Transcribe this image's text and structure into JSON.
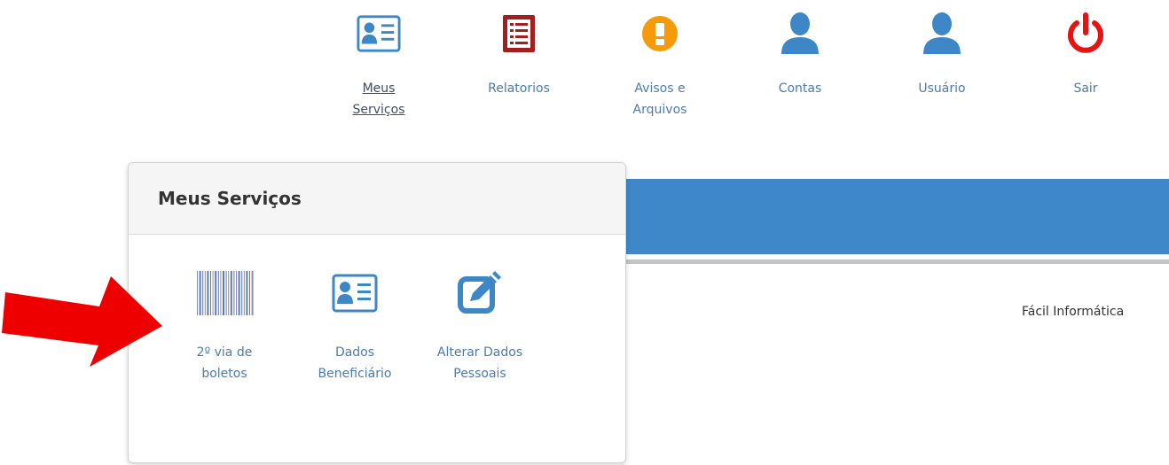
{
  "nav": {
    "items": [
      {
        "label": "Meus\nServiços",
        "icon": "id-card-icon",
        "active": true
      },
      {
        "label": "Relatorios",
        "icon": "report-list-icon"
      },
      {
        "label": "Avisos e\nArquivos",
        "icon": "alert-icon"
      },
      {
        "label": "Contas",
        "icon": "user-icon"
      },
      {
        "label": "Usuário",
        "icon": "user-icon"
      },
      {
        "label": "Sair",
        "icon": "power-icon"
      }
    ]
  },
  "panel": {
    "title": "Meus Serviços",
    "items": [
      {
        "label": "2º via de\nboletos",
        "icon": "barcode-icon"
      },
      {
        "label": "Dados\nBeneficiário",
        "icon": "id-card-icon"
      },
      {
        "label": "Alterar Dados\nPessoais",
        "icon": "edit-icon"
      }
    ]
  },
  "footer": {
    "text": "Fácil Informática"
  },
  "colors": {
    "link": "#4b7bb0",
    "nav_blue": "#3d87c6",
    "report_red": "#a21f1f",
    "alert_orange": "#f59a0a",
    "power_red": "#e81212",
    "band_blue": "#3e88c9",
    "arrow_red": "#ee0000"
  }
}
